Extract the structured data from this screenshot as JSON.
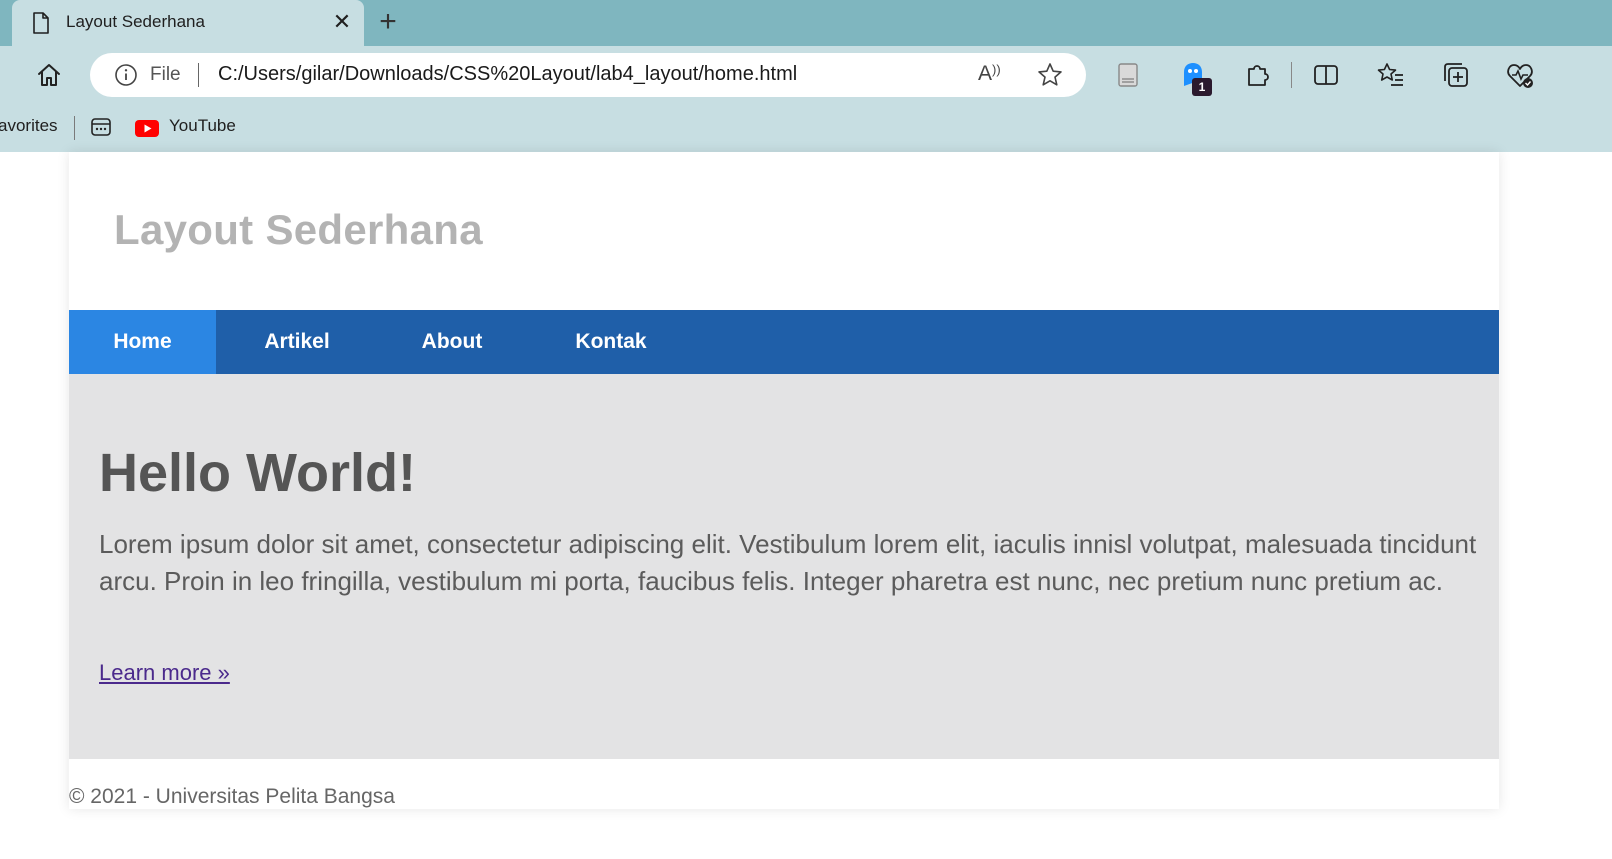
{
  "browser": {
    "tab": {
      "title": "Layout Sederhana",
      "icon": "page-icon",
      "close_icon": "close-icon"
    },
    "new_tab_icon": "plus-icon",
    "toolbar": {
      "home_icon": "home-icon",
      "info_icon": "info-icon",
      "scheme_label": "File",
      "url": "C:/Users/gilar/Downloads/CSS%20Layout/lab4_layout/home.html",
      "read_aloud_label": "Aͅ",
      "extension_badge": "1"
    },
    "bookmarks": {
      "favorites_label": "avorites",
      "items": [
        {
          "label": "YouTube",
          "icon": "youtube-icon"
        }
      ]
    }
  },
  "site": {
    "title": "Layout Sederhana",
    "nav": [
      {
        "label": "Home",
        "active": true
      },
      {
        "label": "Artikel",
        "active": false
      },
      {
        "label": "About",
        "active": false
      },
      {
        "label": "Kontak",
        "active": false
      }
    ],
    "hero": {
      "heading": "Hello World!",
      "body": "Lorem ipsum dolor sit amet, consectetur adipiscing elit. Vestibulum lorem elit, iaculis innisl volutpat, malesuada tincidunt arcu. Proin in leo fringilla, vestibulum mi porta, faucibus felis. Integer pharetra est nunc, nec pretium nunc pretium ac.",
      "link": "Learn more »"
    },
    "footer": "© 2021 - Universitas Pelita Bangsa"
  },
  "colors": {
    "tabstrip": "#7fb6bf",
    "toolbar": "#c7dee2",
    "nav_bg": "#1f5fa9",
    "nav_active": "#2b86e3",
    "hero_bg": "#e3e3e4",
    "site_title": "#b3b3b3"
  }
}
